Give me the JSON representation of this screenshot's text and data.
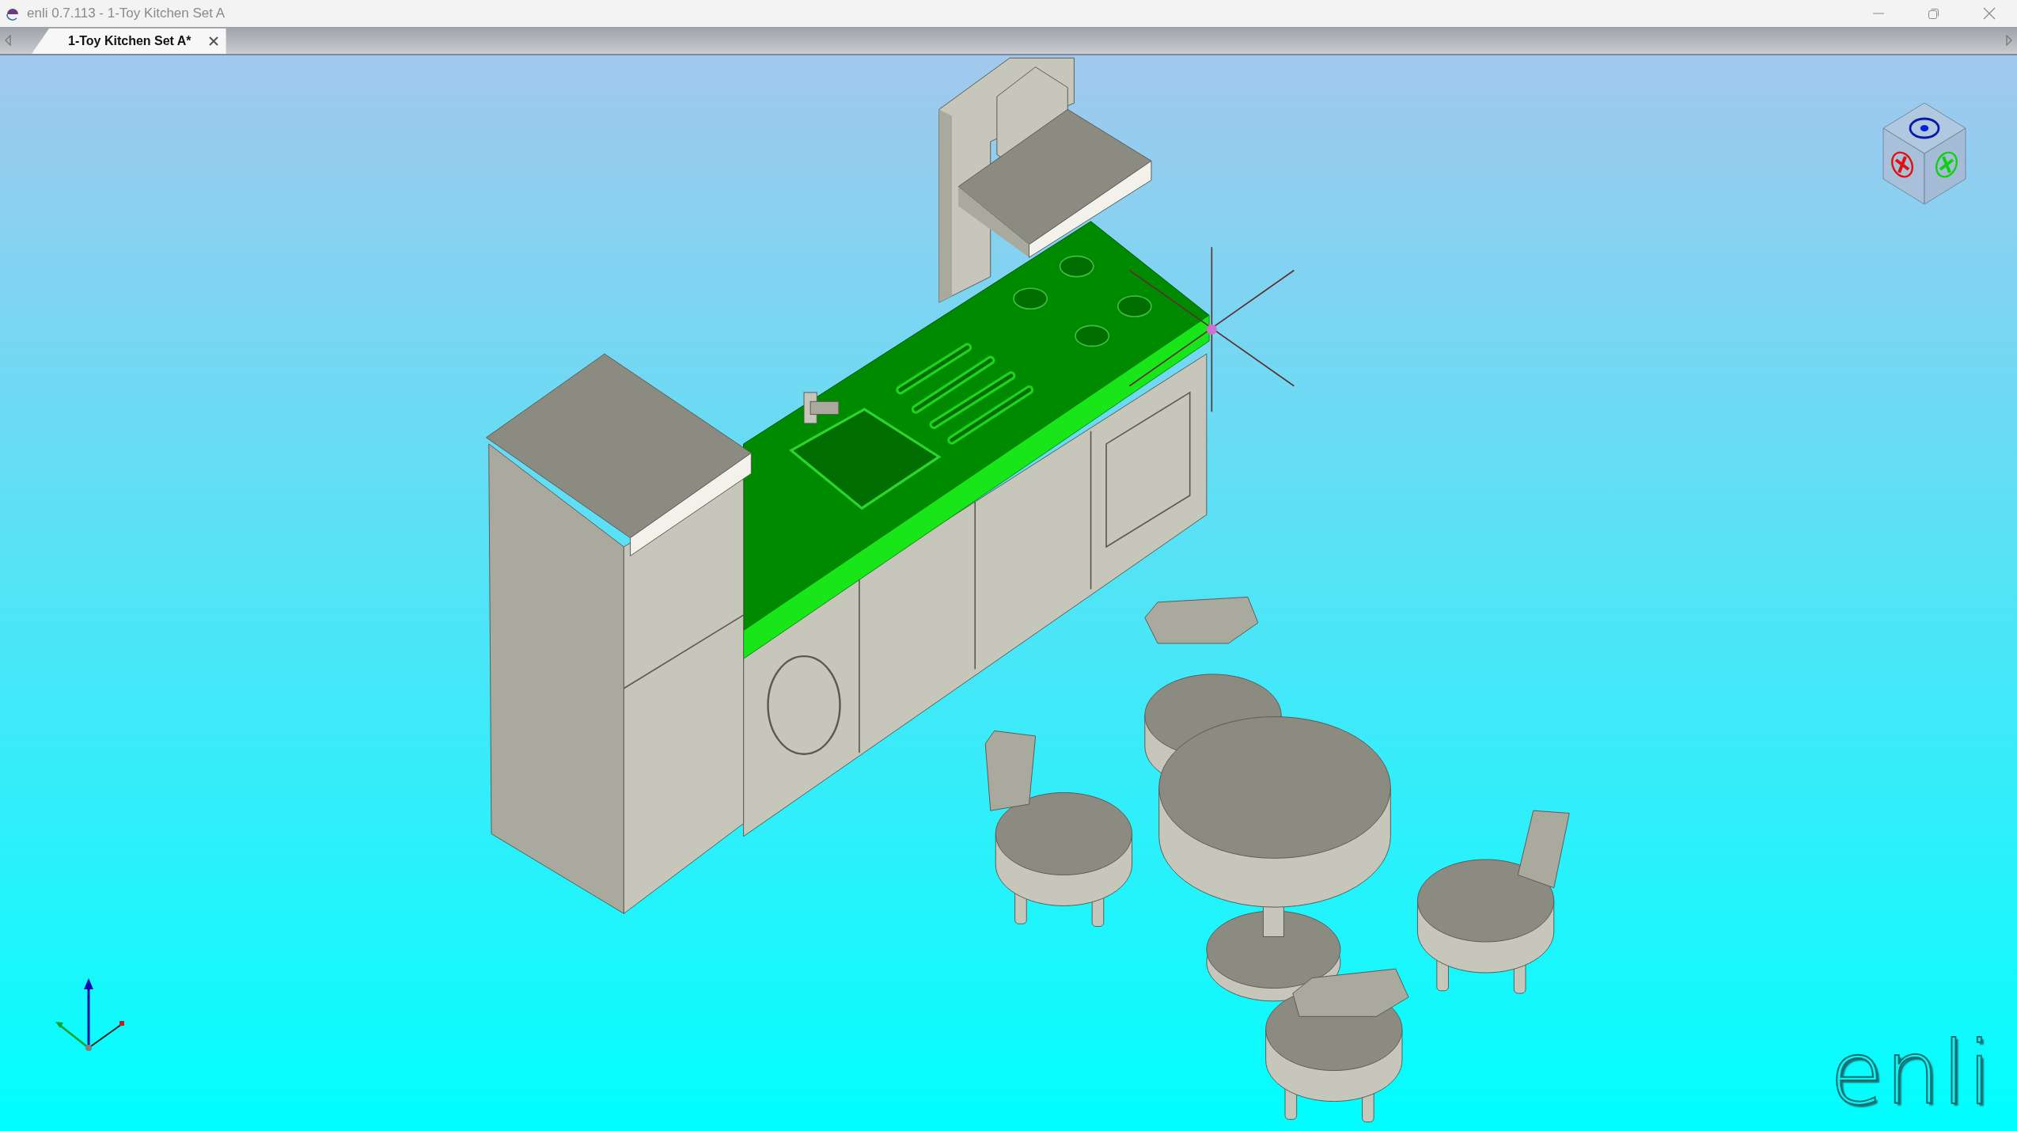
{
  "window": {
    "title": "enli 0.7.113 - 1-Toy Kitchen Set A"
  },
  "tabs": [
    {
      "label": "1-Toy Kitchen Set A*",
      "selected": true
    }
  ],
  "viewport": {
    "logo": "enli"
  }
}
